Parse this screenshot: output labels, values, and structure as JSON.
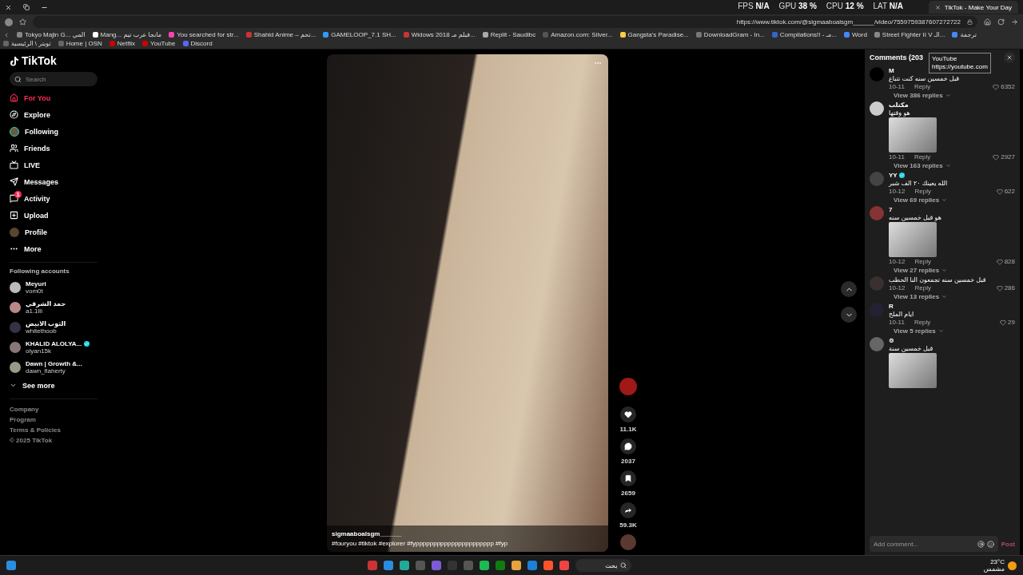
{
  "browser": {
    "tab_title": "TikTok - Make Your Day",
    "url": "https://www.tiktok.com/@sigmaaboalsgm______/video/7559759387607272722",
    "perf": [
      {
        "label": "FPS",
        "value": "N/A"
      },
      {
        "label": "GPU",
        "value": "38 %"
      },
      {
        "label": "CPU",
        "value": "12 %"
      },
      {
        "label": "LAT",
        "value": "N/A"
      }
    ],
    "bookmarks": [
      "Tokyo Majin G... المي",
      "Mang... مانجا عرب تيم",
      "You searched for str...",
      "Shahid Anime – تحم...",
      "GAMELOOP_7.1 SH...",
      "Widows 2018 فيلم مـ...",
      "Replit - Saudibc",
      "Amazon.com: Silver...",
      "Gangsta's Paradise...",
      "DownloadGram - In...",
      "Compilations!! - مـ...",
      "Word",
      "Street Fighter II V الـ...",
      "ترجمة",
      "تويتر \\ الرئيسية",
      "Home | OSN",
      "Netflix",
      "YouTube",
      "Discord"
    ],
    "tooltip": {
      "title": "YouTube",
      "url": "https://youtube.com"
    }
  },
  "sidebar": {
    "logo": "TikTok",
    "search_placeholder": "Search",
    "nav": [
      {
        "label": "For You",
        "kind": "home",
        "selected": true
      },
      {
        "label": "Explore",
        "kind": "explore",
        "selected": false
      },
      {
        "label": "Following",
        "kind": "following",
        "selected": false
      },
      {
        "label": "Friends",
        "kind": "friends",
        "selected": false
      },
      {
        "label": "LIVE",
        "kind": "live",
        "selected": false
      },
      {
        "label": "Messages",
        "kind": "messages",
        "selected": false
      },
      {
        "label": "Activity",
        "kind": "activity",
        "selected": false,
        "badge": "1"
      },
      {
        "label": "Upload",
        "kind": "upload",
        "selected": false
      },
      {
        "label": "Profile",
        "kind": "profile",
        "selected": false
      },
      {
        "label": "More",
        "kind": "more",
        "selected": false
      }
    ],
    "following_title": "Following accounts",
    "accounts": [
      {
        "name": "Meyuri",
        "handle": "vom0t",
        "verified": false
      },
      {
        "name": "حمد الشرقي",
        "handle": "a1.1lli",
        "verified": false
      },
      {
        "name": "الثوب الابيض",
        "handle": "whitethoob",
        "verified": false
      },
      {
        "name": "KHALID ALOLYA...",
        "handle": "olyan15k",
        "verified": true
      },
      {
        "name": "Dawn | Growth &...",
        "handle": "dawn_flaherty",
        "verified": false
      }
    ],
    "see_more": "See more",
    "footer": [
      "Company",
      "Program",
      "Terms & Policies"
    ],
    "copyright": "© 2025 TikTok"
  },
  "video": {
    "author": "sigmaaboalsgm______",
    "hashtags": "#fouryou #tiktok #explorer #fypppppppppppppppppppppp #fyp",
    "actions": [
      {
        "kind": "like",
        "count": "11.1K"
      },
      {
        "kind": "comment",
        "count": "2037"
      },
      {
        "kind": "save",
        "count": "2659"
      },
      {
        "kind": "share",
        "count": "59.3K"
      }
    ]
  },
  "comments": {
    "title": "Comments (203",
    "items": [
      {
        "author": "M",
        "verified": false,
        "text": "قبل خمسين سنه كنت تتباع",
        "image": false,
        "date": "10-11",
        "reply": "Reply",
        "likes": "6352",
        "replies": "View 386 replies"
      },
      {
        "author": "مكتلب",
        "verified": false,
        "text": "هو وقتها",
        "image": true,
        "date": "10-11",
        "reply": "Reply",
        "likes": "2927",
        "replies": "View 163 replies"
      },
      {
        "author": "YY",
        "verified": true,
        "text": "الله يعينك ٢٠ الف شبر",
        "image": false,
        "date": "10-12",
        "reply": "Reply",
        "likes": "622",
        "replies": "View 69 replies"
      },
      {
        "author": "7",
        "verified": false,
        "text": "هو قبل خمسين سنه",
        "image": true,
        "date": "10-12",
        "reply": "Reply",
        "likes": "828",
        "replies": "View 27 replies"
      },
      {
        "text": "قبل خمسين سنه تجمعون النا الحطب",
        "image": false,
        "date": "10-12",
        "reply": "Reply",
        "likes": "286",
        "replies": "View 13 replies"
      },
      {
        "author": "R",
        "verified": false,
        "text": "ايام الملح",
        "image": false,
        "date": "10-11",
        "reply": "Reply",
        "likes": "29",
        "replies": "View 5 replies"
      },
      {
        "author": "⊚",
        "verified": false,
        "text": "قبل خمسين سنة",
        "image": true
      }
    ],
    "placeholder": "Add comment...",
    "post": {
      "label": "Post",
      "disabled": true
    }
  },
  "taskbar": {
    "search": "بحث",
    "weather": {
      "temp": "23°C",
      "desc": "مشمس"
    }
  }
}
